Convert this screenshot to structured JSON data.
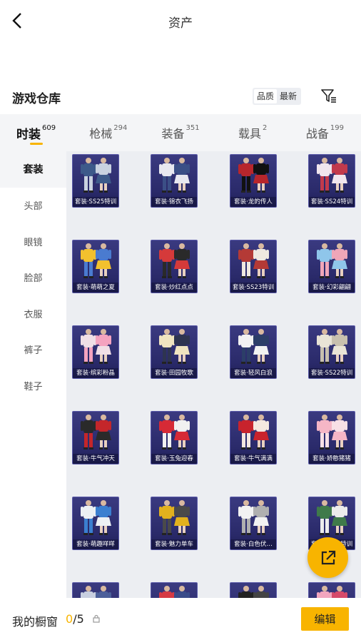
{
  "header": {
    "title": "资产"
  },
  "warehouse": {
    "title": "游戏仓库"
  },
  "sort": {
    "options": [
      "品质",
      "最新"
    ]
  },
  "tabs": [
    {
      "label": "时装",
      "count": "609",
      "active": true
    },
    {
      "label": "枪械",
      "count": "294"
    },
    {
      "label": "装备",
      "count": "351"
    },
    {
      "label": "载具",
      "count": "2"
    },
    {
      "label": "战备",
      "count": "199"
    }
  ],
  "sidebar": [
    {
      "label": "套装",
      "active": true
    },
    {
      "label": "头部"
    },
    {
      "label": "眼镜"
    },
    {
      "label": "脸部"
    },
    {
      "label": "衣服"
    },
    {
      "label": "裤子"
    },
    {
      "label": "鞋子"
    }
  ],
  "items": [
    {
      "label": "套装·SS25特训",
      "colors": [
        "#3d5a8a",
        "#c9d2e0"
      ]
    },
    {
      "label": "套装·锦衣飞扬",
      "colors": [
        "#e8e8f0",
        "#3b4f86"
      ]
    },
    {
      "label": "套装·龙的传人",
      "colors": [
        "#b8262c",
        "#111111"
      ]
    },
    {
      "label": "套装·SS24特训",
      "colors": [
        "#f1e6ee",
        "#c23a4c"
      ]
    },
    {
      "label": "套装·萌萌之夏",
      "colors": [
        "#f2c12e",
        "#4a7bd0"
      ]
    },
    {
      "label": "套装·炒红点点",
      "colors": [
        "#d53a3a",
        "#2a2a2a"
      ]
    },
    {
      "label": "套装·SS23特训",
      "colors": [
        "#b43a36",
        "#efe9e0"
      ]
    },
    {
      "label": "套装·幻彩翩翩",
      "colors": [
        "#8fc6ea",
        "#f0a6b8"
      ]
    },
    {
      "label": "套装·缤彩粉晶",
      "colors": [
        "#f0dfe6",
        "#f4a3bf"
      ]
    },
    {
      "label": "套装·田园牧歌",
      "colors": [
        "#f0e4c0",
        "#2e3450"
      ]
    },
    {
      "label": "套装·轻风白浪",
      "colors": [
        "#f2f2f2",
        "#2c3e68"
      ]
    },
    {
      "label": "套装·SS22特训",
      "colors": [
        "#e9e4d6",
        "#c8c0ae"
      ]
    },
    {
      "label": "套装·牛气冲天",
      "colors": [
        "#2a2a2a",
        "#c4262a"
      ]
    },
    {
      "label": "套装·玉兔迎春",
      "colors": [
        "#d62a36",
        "#f1f1f1"
      ]
    },
    {
      "label": "套装·牛气满满",
      "colors": [
        "#c8232d",
        "#f4e8e0"
      ]
    },
    {
      "label": "套装·娇憨猪猪",
      "colors": [
        "#f5b6c6",
        "#f8e0e6"
      ]
    },
    {
      "label": "套装·萌趣咩咩",
      "colors": [
        "#ecf0f4",
        "#3b7fd0"
      ]
    },
    {
      "label": "套装·魅力单车",
      "colors": [
        "#e2b11e",
        "#4a4a4a"
      ]
    },
    {
      "label": "套装·白色伏…",
      "colors": [
        "#f2f2f2",
        "#b0b0b0"
      ]
    },
    {
      "label": "套装·SS21特训",
      "colors": [
        "#3f7a4a",
        "#ececec"
      ]
    },
    {
      "label": "",
      "colors": [
        "#c8cfe0",
        "#4c5f9a"
      ]
    },
    {
      "label": "",
      "colors": [
        "#d63a44",
        "#3a4c8a"
      ]
    },
    {
      "label": "",
      "colors": [
        "#222222",
        "#444444"
      ]
    },
    {
      "label": "",
      "colors": [
        "#f2a6be",
        "#d64a6a"
      ]
    }
  ],
  "bottom": {
    "showcase_label": "我的橱窗",
    "showcase_used": "0",
    "showcase_sep": "/",
    "showcase_total": "5",
    "edit_label": "编辑"
  },
  "colors": {
    "accent": "#f8b400"
  },
  "icons": {
    "back": "chevron-left-icon",
    "filter": "filter-icon",
    "share": "share-icon",
    "lock": "lock-icon"
  }
}
